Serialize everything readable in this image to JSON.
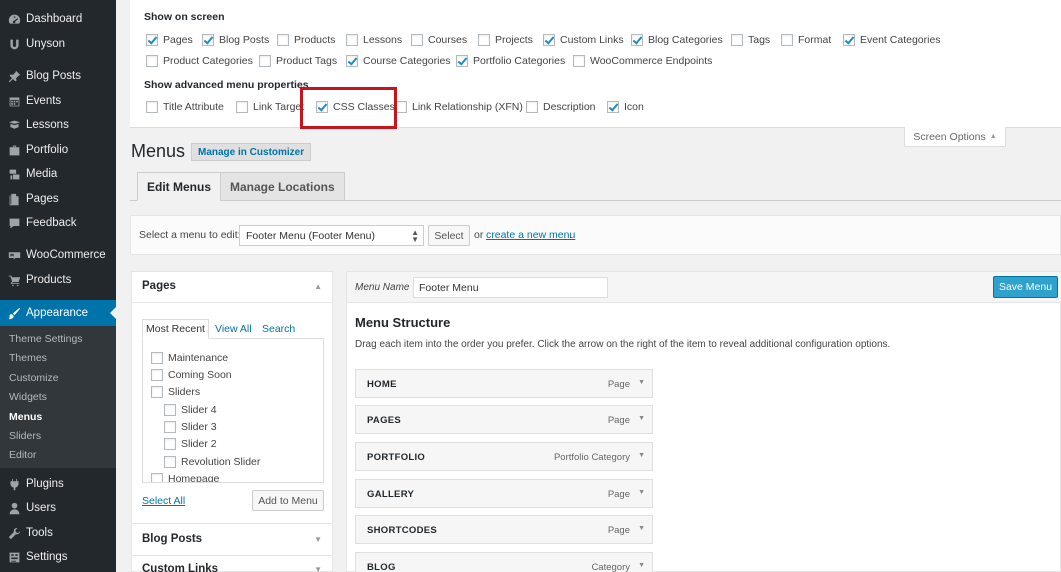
{
  "sidebar": {
    "items": [
      {
        "label": "Dashboard",
        "icon": "dashboard-icon"
      },
      {
        "label": "Unyson",
        "icon": "unyson-icon"
      },
      {
        "label": "Blog Posts",
        "icon": "pin-icon"
      },
      {
        "label": "Events",
        "icon": "calendar-icon"
      },
      {
        "label": "Lessons",
        "icon": "book-icon"
      },
      {
        "label": "Portfolio",
        "icon": "portfolio-icon"
      },
      {
        "label": "Media",
        "icon": "media-icon"
      },
      {
        "label": "Pages",
        "icon": "page-icon"
      },
      {
        "label": "Feedback",
        "icon": "comment-icon"
      },
      {
        "label": "WooCommerce",
        "icon": "woocommerce-icon"
      },
      {
        "label": "Products",
        "icon": "cart-icon"
      },
      {
        "label": "Appearance",
        "icon": "brush-icon"
      },
      {
        "label": "Plugins",
        "icon": "plugin-icon"
      },
      {
        "label": "Users",
        "icon": "user-icon"
      },
      {
        "label": "Tools",
        "icon": "wrench-icon"
      },
      {
        "label": "Settings",
        "icon": "settings-icon"
      }
    ],
    "submenu": [
      "Theme Settings",
      "Themes",
      "Customize",
      "Widgets",
      "Menus",
      "Sliders",
      "Editor"
    ],
    "accent_color": "#0073aa"
  },
  "screen_options": {
    "show_on_screen_heading": "Show on screen",
    "show_on_screen": [
      {
        "label": "Pages",
        "checked": true
      },
      {
        "label": "Blog Posts",
        "checked": true
      },
      {
        "label": "Products",
        "checked": false
      },
      {
        "label": "Lessons",
        "checked": false
      },
      {
        "label": "Courses",
        "checked": false
      },
      {
        "label": "Projects",
        "checked": false
      },
      {
        "label": "Custom Links",
        "checked": true
      },
      {
        "label": "Blog Categories",
        "checked": true
      },
      {
        "label": "Tags",
        "checked": false
      },
      {
        "label": "Format",
        "checked": false
      },
      {
        "label": "Event Categories",
        "checked": true
      },
      {
        "label": "Product Categories",
        "checked": false
      },
      {
        "label": "Product Tags",
        "checked": false
      },
      {
        "label": "Course Categories",
        "checked": true
      },
      {
        "label": "Portfolio Categories",
        "checked": true
      },
      {
        "label": "WooCommerce Endpoints",
        "checked": false
      }
    ],
    "advanced_heading": "Show advanced menu properties",
    "advanced": [
      {
        "label": "Title Attribute",
        "checked": false
      },
      {
        "label": "Link Target",
        "checked": false
      },
      {
        "label": "CSS Classes",
        "checked": true
      },
      {
        "label": "Link Relationship (XFN)",
        "checked": false
      },
      {
        "label": "Description",
        "checked": false
      },
      {
        "label": "Icon",
        "checked": true
      }
    ],
    "tab_label": "Screen Options",
    "tab_arrow": "▲",
    "highlight_color": "#c4161c"
  },
  "page": {
    "title": "Menus",
    "manage_customizer": "Manage in Customizer"
  },
  "tabs": [
    "Edit Menus",
    "Manage Locations"
  ],
  "select_bar": {
    "label": "Select a menu to edit:",
    "selected": "Footer Menu (Footer Menu)",
    "select_button": "Select",
    "or_text": "or",
    "create_link": "create a new menu",
    "period": "."
  },
  "left_panel": {
    "pages_title": "Pages",
    "page_tabs": [
      "Most Recent",
      "View All",
      "Search"
    ],
    "pages": [
      {
        "label": "Maintenance",
        "indent": 0
      },
      {
        "label": "Coming Soon",
        "indent": 0
      },
      {
        "label": "Sliders",
        "indent": 0
      },
      {
        "label": "Slider 4",
        "indent": 1
      },
      {
        "label": "Slider 3",
        "indent": 1
      },
      {
        "label": "Slider 2",
        "indent": 1
      },
      {
        "label": "Revolution Slider",
        "indent": 1
      },
      {
        "label": "Homepage",
        "indent": 0
      }
    ],
    "select_all": "Select All",
    "add_to_menu": "Add to Menu",
    "sections": [
      "Blog Posts",
      "Custom Links"
    ]
  },
  "right_panel": {
    "menu_name_label": "Menu Name",
    "menu_name_value": "Footer Menu",
    "save_button": "Save Menu",
    "structure_title": "Menu Structure",
    "structure_desc": "Drag each item into the order you prefer. Click the arrow on the right of the item to reveal additional configuration options.",
    "items": [
      {
        "title": "HOME",
        "type": "Page"
      },
      {
        "title": "PAGES",
        "type": "Page"
      },
      {
        "title": "PORTFOLIO",
        "type": "Portfolio Category"
      },
      {
        "title": "GALLERY",
        "type": "Page"
      },
      {
        "title": "SHORTCODES",
        "type": "Page"
      },
      {
        "title": "BLOG",
        "type": "Category"
      }
    ]
  }
}
